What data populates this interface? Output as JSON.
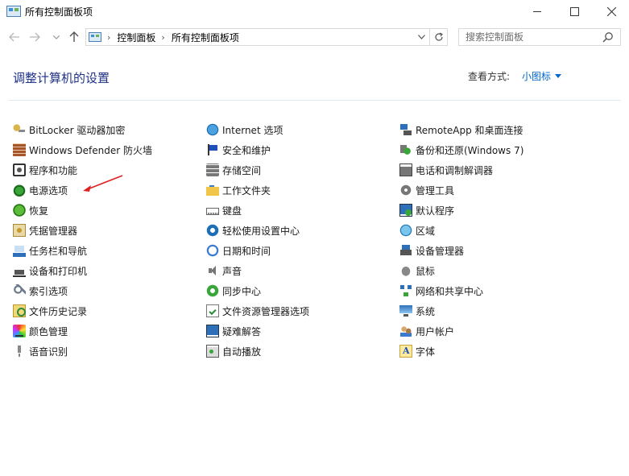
{
  "window": {
    "title": "所有控制面板项"
  },
  "address": {
    "breadcrumbs": [
      "控制面板",
      "所有控制面板项"
    ],
    "search_placeholder": "搜索控制面板"
  },
  "header": {
    "title": "调整计算机的设置",
    "view_by_label": "查看方式:",
    "view_by_value": "小图标"
  },
  "columns": [
    [
      {
        "label": "BitLocker 驱动器加密",
        "icon": "bitlocker-key-icon"
      },
      {
        "label": "Windows Defender 防火墙",
        "icon": "firewall-icon"
      },
      {
        "label": "程序和功能",
        "icon": "programs-icon"
      },
      {
        "label": "电源选项",
        "icon": "power-icon"
      },
      {
        "label": "恢复",
        "icon": "recovery-icon"
      },
      {
        "label": "凭据管理器",
        "icon": "credential-icon"
      },
      {
        "label": "任务栏和导航",
        "icon": "taskbar-icon"
      },
      {
        "label": "设备和打印机",
        "icon": "printer-icon"
      },
      {
        "label": "索引选项",
        "icon": "index-icon"
      },
      {
        "label": "文件历史记录",
        "icon": "file-history-icon"
      },
      {
        "label": "颜色管理",
        "icon": "color-management-icon"
      },
      {
        "label": "语音识别",
        "icon": "microphone-icon"
      }
    ],
    [
      {
        "label": "Internet 选项",
        "icon": "internet-globe-icon"
      },
      {
        "label": "安全和维护",
        "icon": "flag-icon"
      },
      {
        "label": "存储空间",
        "icon": "storage-icon"
      },
      {
        "label": "工作文件夹",
        "icon": "work-folder-icon"
      },
      {
        "label": "键盘",
        "icon": "keyboard-icon"
      },
      {
        "label": "轻松使用设置中心",
        "icon": "ease-of-access-icon"
      },
      {
        "label": "日期和时间",
        "icon": "clock-icon"
      },
      {
        "label": "声音",
        "icon": "speaker-icon"
      },
      {
        "label": "同步中心",
        "icon": "sync-icon"
      },
      {
        "label": "文件资源管理器选项",
        "icon": "explorer-options-icon"
      },
      {
        "label": "疑难解答",
        "icon": "troubleshooting-icon"
      },
      {
        "label": "自动播放",
        "icon": "autoplay-icon"
      }
    ],
    [
      {
        "label": "RemoteApp 和桌面连接",
        "icon": "remote-desktop-icon"
      },
      {
        "label": "备份和还原(Windows 7)",
        "icon": "backup-icon"
      },
      {
        "label": "电话和调制解调器",
        "icon": "phone-modem-icon"
      },
      {
        "label": "管理工具",
        "icon": "admin-tools-icon"
      },
      {
        "label": "默认程序",
        "icon": "default-programs-icon"
      },
      {
        "label": "区域",
        "icon": "region-globe-icon"
      },
      {
        "label": "设备管理器",
        "icon": "device-manager-icon"
      },
      {
        "label": "鼠标",
        "icon": "mouse-icon"
      },
      {
        "label": "网络和共享中心",
        "icon": "network-icon"
      },
      {
        "label": "系统",
        "icon": "system-monitor-icon"
      },
      {
        "label": "用户帐户",
        "icon": "user-accounts-icon"
      },
      {
        "label": "字体",
        "icon": "font-icon"
      }
    ]
  ],
  "colors": {
    "title_blue": "#1e3287",
    "link_blue": "#0066cc",
    "arrow_red": "#e02020"
  }
}
